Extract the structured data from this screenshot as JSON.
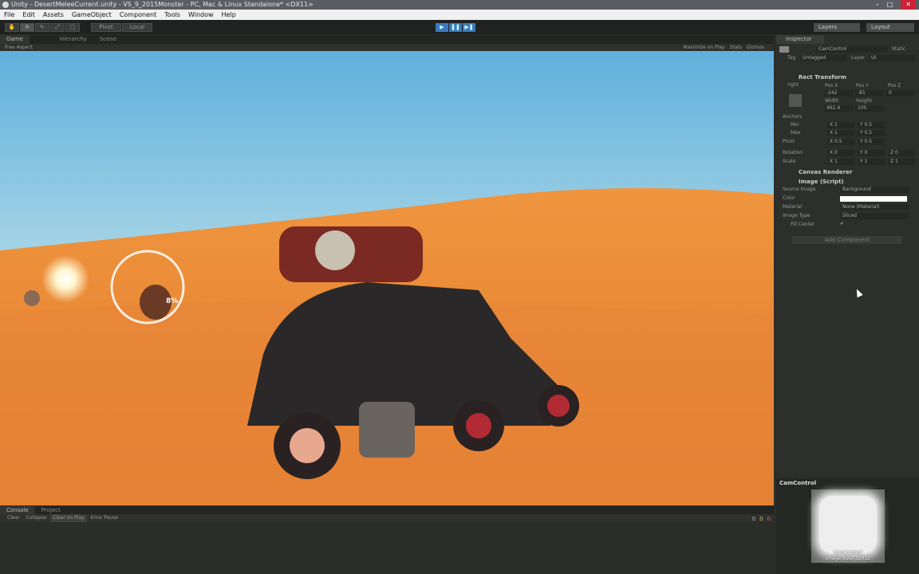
{
  "window": {
    "title": "Unity - DesertMeleeCurrent.unity - VS_9_2015Monster - PC, Mac & Linux Standalone* <DX11>",
    "min": "–",
    "max": "□",
    "close": "✕"
  },
  "menu": [
    "File",
    "Edit",
    "Assets",
    "GameObject",
    "Component",
    "Tools",
    "Window",
    "Help"
  ],
  "toolbar": {
    "pivot": "Pivot",
    "local": "Local",
    "play": "▶",
    "pause": "❚❚",
    "step": "▶❚",
    "layers": "Layers",
    "layout": "Layout"
  },
  "tabs": {
    "game": "Game",
    "hierarchy": "Hierarchy",
    "scene": "Scene"
  },
  "gamebar": {
    "aspect": "Free Aspect",
    "maximize": "Maximize on Play",
    "stats": "Stats",
    "gizmos": "Gizmos"
  },
  "game": {
    "progress_label": "8%"
  },
  "inspector": {
    "tab": "Inspector",
    "object": "CamControl",
    "static": "Static",
    "tag_label": "Tag",
    "tag": "Untagged",
    "layer_label": "Layer",
    "layer": "UI",
    "rect": {
      "title": "Rect Transform",
      "anchor_h": "right",
      "anchor_v": "middle",
      "posx_l": "Pos X",
      "posy_l": "Pos Y",
      "posz_l": "Pos Z",
      "posx": "-242",
      "posy": "-81",
      "posz": "0",
      "w_l": "Width",
      "h_l": "Height",
      "w": "461.4",
      "h": "105",
      "anchors": "Anchors",
      "min": "Min",
      "max": "Max",
      "pivot": "Pivot",
      "minx": "X 1",
      "miny": "Y 0.5",
      "maxx": "X 1",
      "maxy": "Y 0.5",
      "pivx": "X 0.5",
      "pivy": "Y 0.5",
      "rotation": "Rotation",
      "scale": "Scale",
      "rx": "X 0",
      "ry": "Y 0",
      "rz": "Z 0",
      "sx": "X 1",
      "sy": "Y 1",
      "sz": "Z 1"
    },
    "canvas_renderer": "Canvas Renderer",
    "image": {
      "title": "Image (Script)",
      "source_l": "Source Image",
      "source": "Background",
      "color_l": "Color",
      "material_l": "Material",
      "material": "None (Material)",
      "type_l": "Image Type",
      "type": "Sliced",
      "fill_l": "Fill Center",
      "fill": "✓"
    },
    "add_component": "Add Component"
  },
  "preview": {
    "title": "CamControl",
    "name": "CamControl",
    "size": "Image Size: 32x32"
  },
  "console": {
    "tab": "Console",
    "project": "Project",
    "clear": "Clear",
    "collapse": "Collapse",
    "clear_play": "Clear on Play",
    "error_pause": "Error Pause",
    "counts": [
      "0",
      "0",
      "0"
    ]
  }
}
